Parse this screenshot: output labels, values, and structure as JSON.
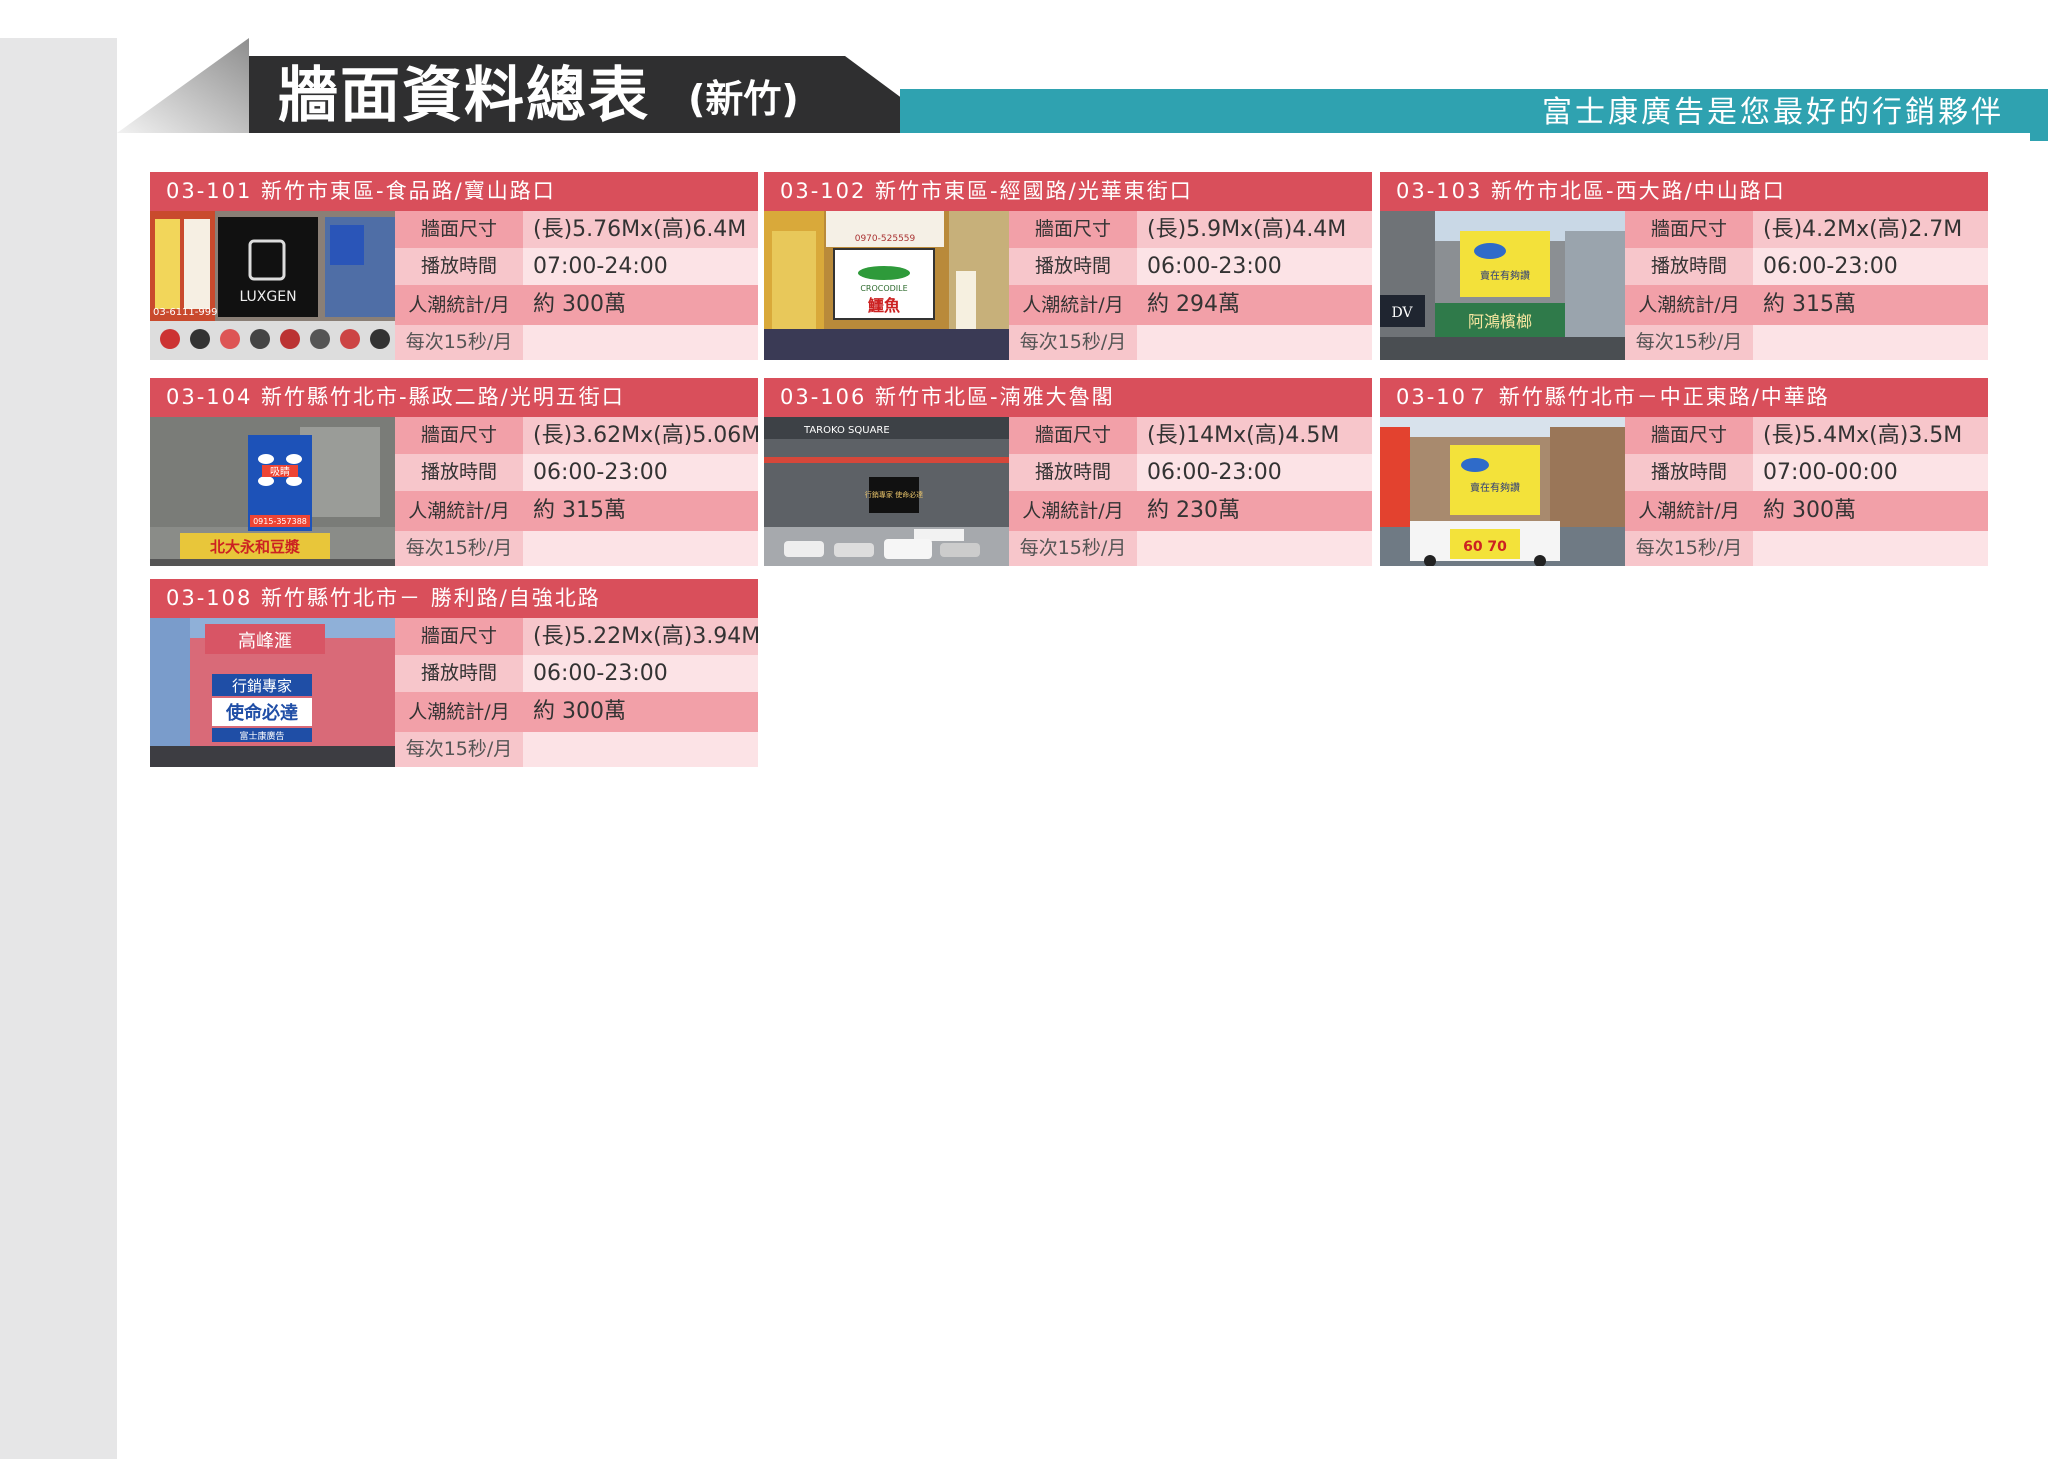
{
  "header": {
    "title": "牆面資料總表",
    "subtitle": "(新竹)",
    "slogan": "富士康廣告是您最好的行銷夥伴"
  },
  "labels": {
    "size": "牆面尺寸",
    "hours": "播放時間",
    "traffic": "人潮統計/月",
    "per_spot": "每次15秒/月"
  },
  "cards": [
    {
      "title": "03-101 新竹市東區-食品路/寶山路口",
      "size": "(長)5.76Mx(高)6.4M",
      "hours": "07:00-24:00",
      "traffic": "約 300萬",
      "per_spot": "",
      "photo": {
        "sign": "LUXGEN",
        "phone": "03-6111-999"
      }
    },
    {
      "title": "03-102 新竹市東區-經國路/光華東街口",
      "size": "(長)5.9Mx(高)4.4M",
      "hours": "06:00-23:00",
      "traffic": "約 294萬",
      "per_spot": "",
      "photo": {
        "sign": "CROCODILE",
        "sign2": "鱷魚",
        "phone": "0970-525559"
      }
    },
    {
      "title": "03-103 新竹市北區-西大路/中山路口",
      "size": "(長)4.2Mx(高)2.7M",
      "hours": "06:00-23:00",
      "traffic": "約 315萬",
      "per_spot": "",
      "photo": {
        "sign": "賣在有夠讚",
        "store": "阿鴻檳榔",
        "shop": "DV"
      }
    },
    {
      "title": "03-104 新竹縣竹北市-縣政二路/光明五街口",
      "size": "(長)3.62Mx(高)5.06M",
      "hours": "06:00-23:00",
      "traffic": "約 315萬",
      "per_spot": "",
      "photo": {
        "sign": "吸睛",
        "phone": "0915-357388",
        "store": "北大永和豆漿"
      }
    },
    {
      "title": "03-106 新竹市北區-湳雅大魯閣",
      "size": "(長)14Mx(高)4.5M",
      "hours": "06:00-23:00",
      "traffic": "約 230萬",
      "per_spot": "",
      "photo": {
        "sign": "TAROKO SQUARE",
        "screen": "行銷專家 使命必達"
      }
    },
    {
      "title": "03-10７ 新竹縣竹北市－中正東路/中華路",
      "size": "(長)5.4Mx(高)3.5M",
      "hours": "07:00-00:00",
      "traffic": "約 300萬",
      "per_spot": "",
      "photo": {
        "sign": "賣在有夠讚",
        "truck": "60  70"
      }
    },
    {
      "title": "03-108 新竹縣竹北市－ 勝利路/自強北路",
      "size": "(長)5.22Mx(高)3.94M",
      "hours": "06:00-23:00",
      "traffic": "約 300萬",
      "per_spot": "",
      "photo": {
        "sign": "高峰滙",
        "line1": "行銷專家",
        "line2": "使命必達",
        "line3": "富士康廣告"
      }
    }
  ]
}
